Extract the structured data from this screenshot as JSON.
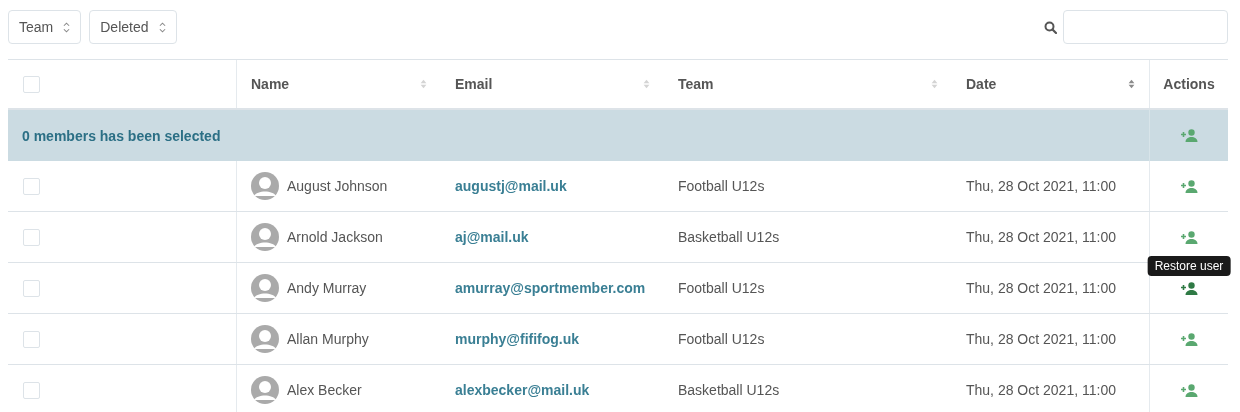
{
  "filters": [
    {
      "label": "Team"
    },
    {
      "label": "Deleted"
    }
  ],
  "table": {
    "columns": [
      {
        "kind": "checkbox"
      },
      {
        "label": "Name",
        "kind": "sortable",
        "sort_active": false
      },
      {
        "label": "Email",
        "kind": "sortable",
        "sort_active": false
      },
      {
        "label": "Team",
        "kind": "sortable",
        "sort_active": false
      },
      {
        "label": "Date",
        "kind": "sortable",
        "sort_active": true
      },
      {
        "label": "Actions",
        "kind": "actions"
      }
    ],
    "header_checked": false,
    "selection_banner": "0 members has been selected",
    "rows": [
      {
        "checked": false,
        "name": "August Johnson",
        "email": "augustj@mail.uk",
        "team": "Football U12s",
        "date": "Thu, 28 Oct 2021, 11:00",
        "hovered": false
      },
      {
        "checked": false,
        "name": "Arnold Jackson",
        "email": "aj@mail.uk",
        "team": "Basketball U12s",
        "date": "Thu, 28 Oct 2021, 11:00",
        "hovered": false
      },
      {
        "checked": false,
        "name": "Andy Murray",
        "email": "amurray@sportmember.com",
        "team": "Football U12s",
        "date": "Thu, 28 Oct 2021, 11:00",
        "hovered": true,
        "tooltip": "Restore user"
      },
      {
        "checked": false,
        "name": "Allan Murphy",
        "email": "murphy@fififog.uk",
        "team": "Football U12s",
        "date": "Thu, 28 Oct 2021, 11:00",
        "hovered": false
      },
      {
        "checked": false,
        "name": "Alex Becker",
        "email": "alexbecker@mail.uk",
        "team": "Basketball U12s",
        "date": "Thu, 28 Oct 2021, 11:00",
        "hovered": false
      }
    ]
  }
}
